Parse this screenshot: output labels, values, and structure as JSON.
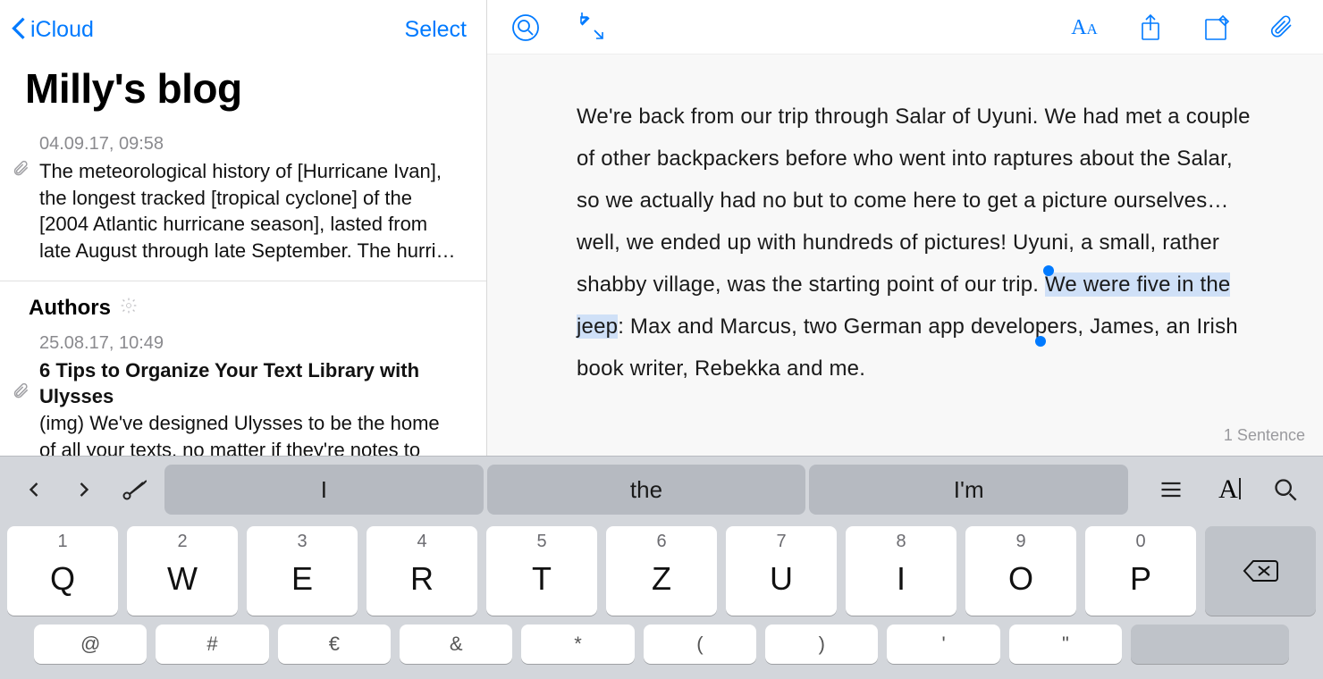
{
  "sidebar": {
    "back_label": "iCloud",
    "select_label": "Select",
    "title": "Milly's blog",
    "notes": [
      {
        "date": "04.09.17, 09:58",
        "preview": "The meteorological history of [Hurricane Ivan], the longest tracked [tropical cyclone] of the [2004 Atlantic hurricane season], lasted from late August through late September. The hurri…",
        "has_attachment": true
      },
      {
        "date": "25.08.17, 10:49",
        "title": "6 Tips to Organize Your Text Library with Ulysses",
        "preview": "(img) We've designed Ulysses to be the home of all your texts, no matter if they're notes to",
        "has_attachment": true
      }
    ],
    "section_header": "Authors"
  },
  "editor": {
    "text_before": "We're back from our trip through Salar of Uyuni. We had met a couple of other backpackers before who went into raptures about the Salar, so we actually had no but to come here to get a picture ourselves… well, we ended up with hundreds of pictures! Uyuni, a small, rather shabby village, was the starting point of our trip. ",
    "selection": "We were five in the jeep",
    "text_after": ": Max and Marcus, two German app developers, James, an Irish book writer, Rebekka and me.",
    "status": "1 Sentence"
  },
  "keyboard": {
    "suggestions": [
      "I",
      "the",
      "I'm"
    ],
    "row_numbers": [
      "1",
      "2",
      "3",
      "4",
      "5",
      "6",
      "7",
      "8",
      "9",
      "0"
    ],
    "row_letters": [
      "Q",
      "W",
      "E",
      "R",
      "T",
      "Z",
      "U",
      "I",
      "O",
      "P"
    ],
    "row2_symbols": [
      "@",
      "#",
      "€",
      "&",
      "*",
      "(",
      ")",
      "'",
      "\""
    ]
  }
}
